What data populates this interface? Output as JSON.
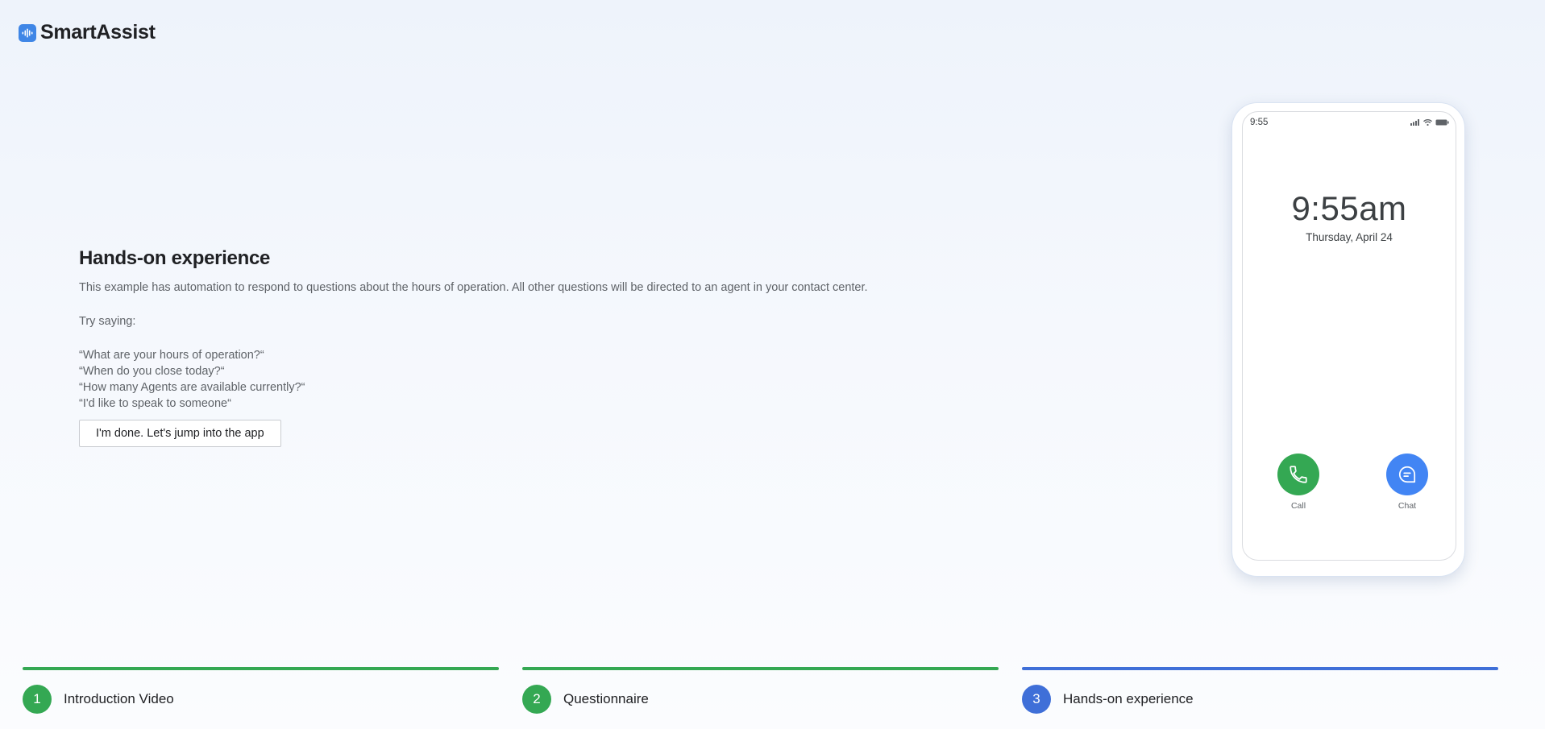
{
  "colors": {
    "green": "#34a853",
    "blue": "#4285f4",
    "active_step": "#3f6fd8"
  },
  "brand": {
    "name": "SmartAssist",
    "logo_icon": "waveform-icon"
  },
  "main": {
    "title": "Hands-on experience",
    "description": "This example has automation to respond to questions about the hours of operation. All other questions will be directed to an agent in your contact center.",
    "try_saying": "Try saying:",
    "examples": [
      "“What are your hours of operation?“",
      "“When do you close today?“",
      "“How many Agents are available currently?“",
      "“I'd like to speak to someone“"
    ],
    "done_button": "I'm done. Let's jump into the app"
  },
  "phone": {
    "status_time": "9:55",
    "status_icons": [
      "signal-icon",
      "wifi-icon",
      "battery-icon"
    ],
    "clock": "9:55am",
    "date": "Thursday, April 24",
    "call_label": "Call",
    "chat_label": "Chat"
  },
  "steps": [
    {
      "number": "1",
      "label": "Introduction Video",
      "status": "complete"
    },
    {
      "number": "2",
      "label": "Questionnaire",
      "status": "complete"
    },
    {
      "number": "3",
      "label": "Hands-on experience",
      "status": "active"
    }
  ]
}
